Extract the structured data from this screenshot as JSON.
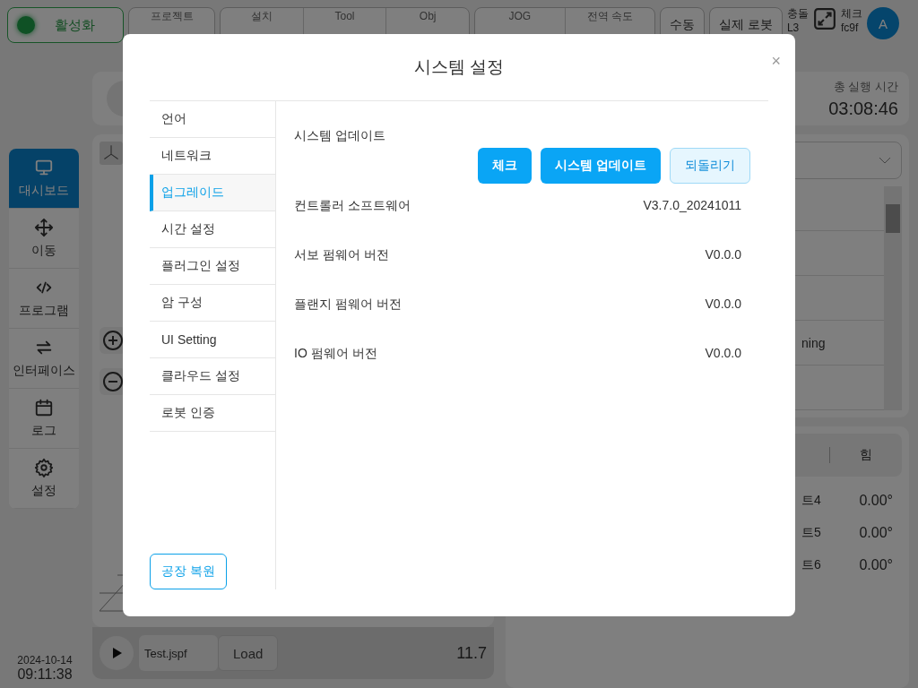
{
  "top_bar": {
    "activate": "활성화",
    "groups": [
      {
        "items": [
          {
            "label": "프로젝트"
          }
        ]
      },
      {
        "items": [
          {
            "label": "설치"
          },
          {
            "label": "Tool"
          },
          {
            "label": "Obj"
          }
        ]
      },
      {
        "items": [
          {
            "label": "JOG"
          },
          {
            "label": "전역 속도"
          }
        ]
      }
    ],
    "mode_button": "수동",
    "robot_button": "실제 로봇",
    "collision": {
      "label": "충돌",
      "value": "L3"
    },
    "check": {
      "label": "체크",
      "value": "fc9f"
    },
    "avatar": "A"
  },
  "nav": [
    {
      "label": "대시보드",
      "kind": "monitor",
      "selected": true
    },
    {
      "label": "이동",
      "kind": "move",
      "selected": false
    },
    {
      "label": "프로그램",
      "kind": "code",
      "selected": false
    },
    {
      "label": "인터페이스",
      "kind": "swap",
      "selected": false
    },
    {
      "label": "로그",
      "kind": "calendar",
      "selected": false
    },
    {
      "label": "설정",
      "kind": "gear",
      "selected": false
    }
  ],
  "datetime": {
    "date": "2024-10-14",
    "time": "09:11:38"
  },
  "run_time": {
    "label": "총 실행 시간",
    "value": "03:08:46"
  },
  "log_list": {
    "visible_text": "ning"
  },
  "joint_panel": {
    "tab": "힘",
    "rows": [
      {
        "label": "트4",
        "value": "0.00°"
      },
      {
        "label": "트5",
        "value": "0.00°"
      },
      {
        "label": "트6",
        "value": "0.00°"
      }
    ]
  },
  "player": {
    "file": "Test.jspf",
    "load": "Load",
    "value": "11.7"
  },
  "dialog": {
    "title": "시스템 설정",
    "close": "×",
    "menu": [
      {
        "label": "언어",
        "selected": false
      },
      {
        "label": "네트워크",
        "selected": false
      },
      {
        "label": "업그레이드",
        "selected": true
      },
      {
        "label": "시간 설정",
        "selected": false
      },
      {
        "label": "플러그인 설정",
        "selected": false
      },
      {
        "label": "암 구성",
        "selected": false
      },
      {
        "label": "UI Setting",
        "selected": false
      },
      {
        "label": "클라우드 설정",
        "selected": false
      },
      {
        "label": "로봇 인증",
        "selected": false
      }
    ],
    "factory_reset": "공장 복원",
    "section_title": "시스템 업데이트",
    "buttons": [
      {
        "label": "체크",
        "kind": "primary"
      },
      {
        "label": "시스템 업데이트",
        "kind": "primary"
      },
      {
        "label": "되돌리기",
        "kind": "secondary"
      }
    ],
    "rows": [
      {
        "label": "컨트롤러 소프트웨어",
        "value": "V3.7.0_20241011"
      },
      {
        "label": "서보 펌웨어 버전",
        "value": "V0.0.0"
      },
      {
        "label": "플랜지 펌웨어 버전",
        "value": "V0.0.0"
      },
      {
        "label": "IO 펌웨어 버전",
        "value": "V0.0.0"
      }
    ]
  }
}
